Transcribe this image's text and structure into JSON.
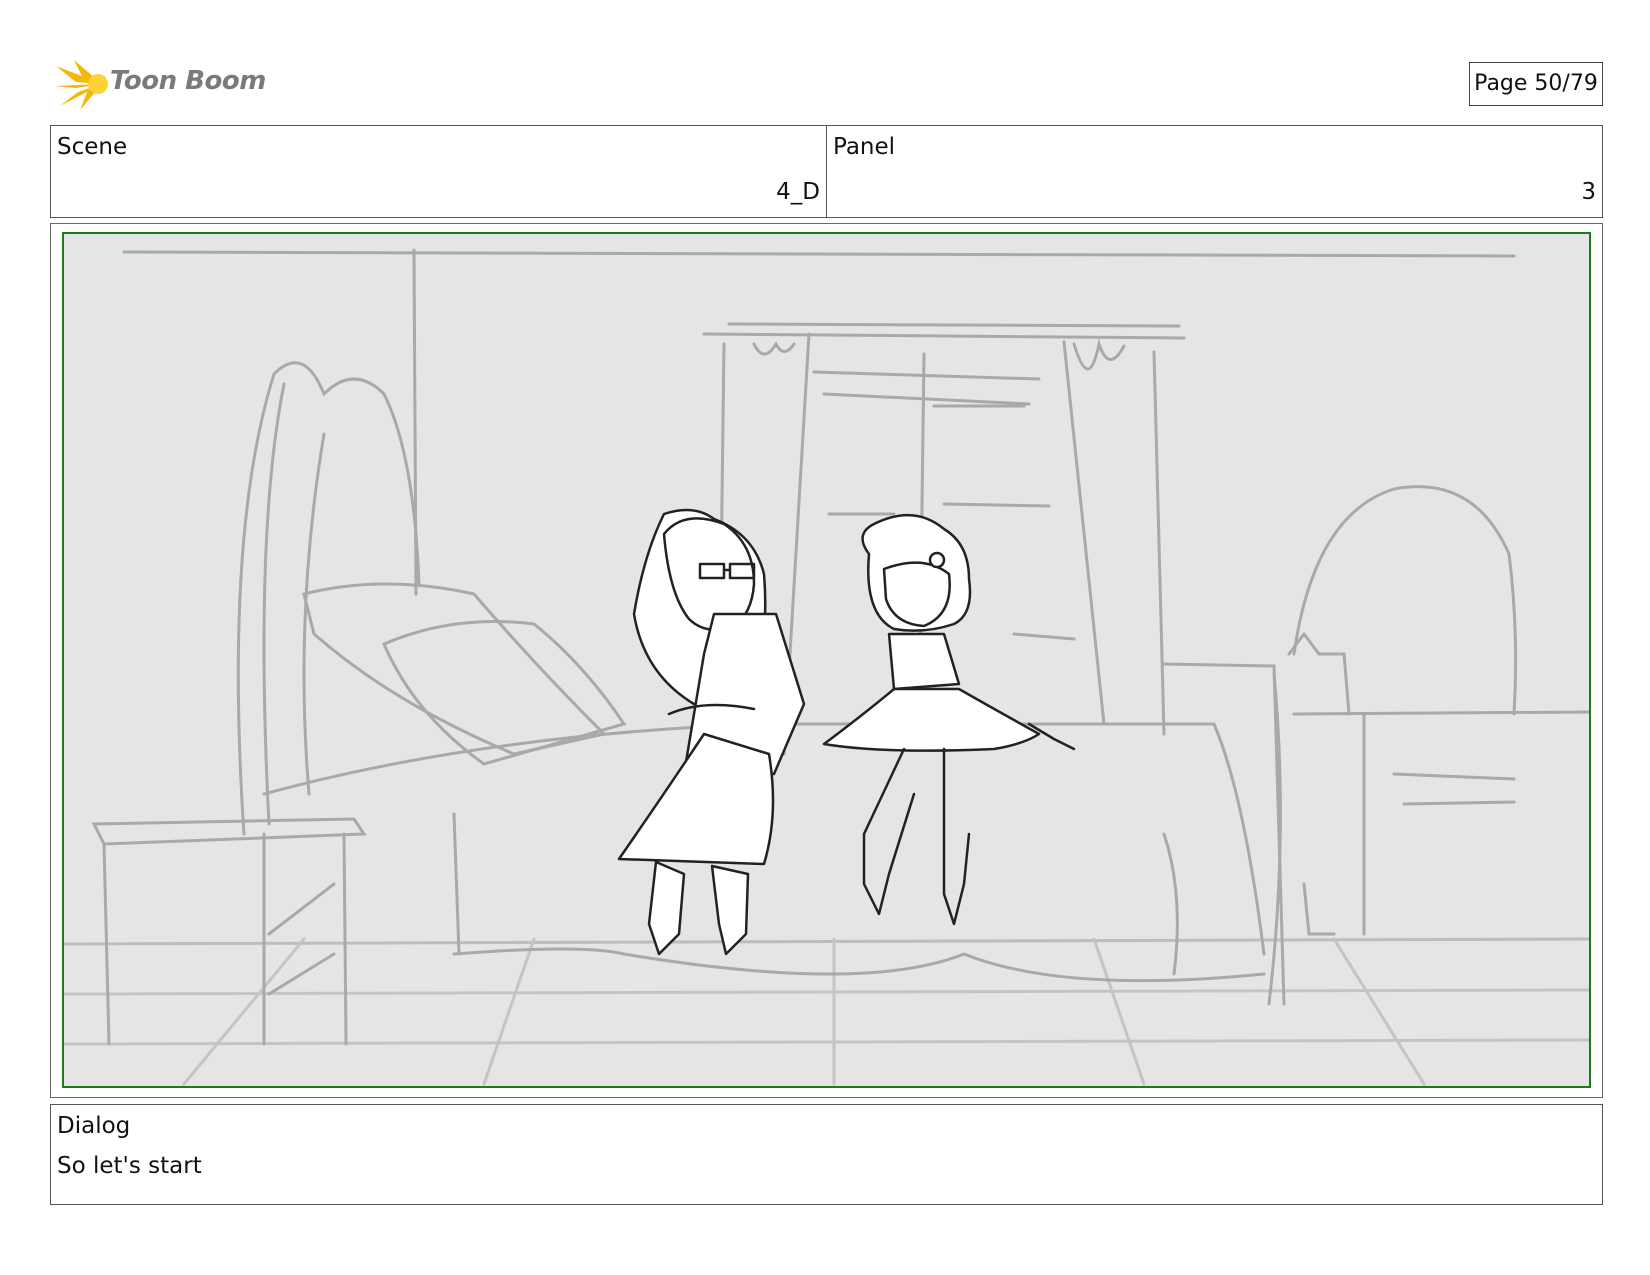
{
  "header": {
    "logo_text": "Toon Boom",
    "page_indicator": "Page 50/79"
  },
  "info": {
    "scene_label": "Scene",
    "scene_value": "4_D",
    "panel_label": "Panel",
    "panel_value": "3"
  },
  "dialog": {
    "label": "Dialog",
    "text": "So let's start"
  },
  "colors": {
    "panel_border": "#1f7a1f",
    "sketch_background": "#e5e5e5",
    "logo_accent": "#f5b800"
  }
}
